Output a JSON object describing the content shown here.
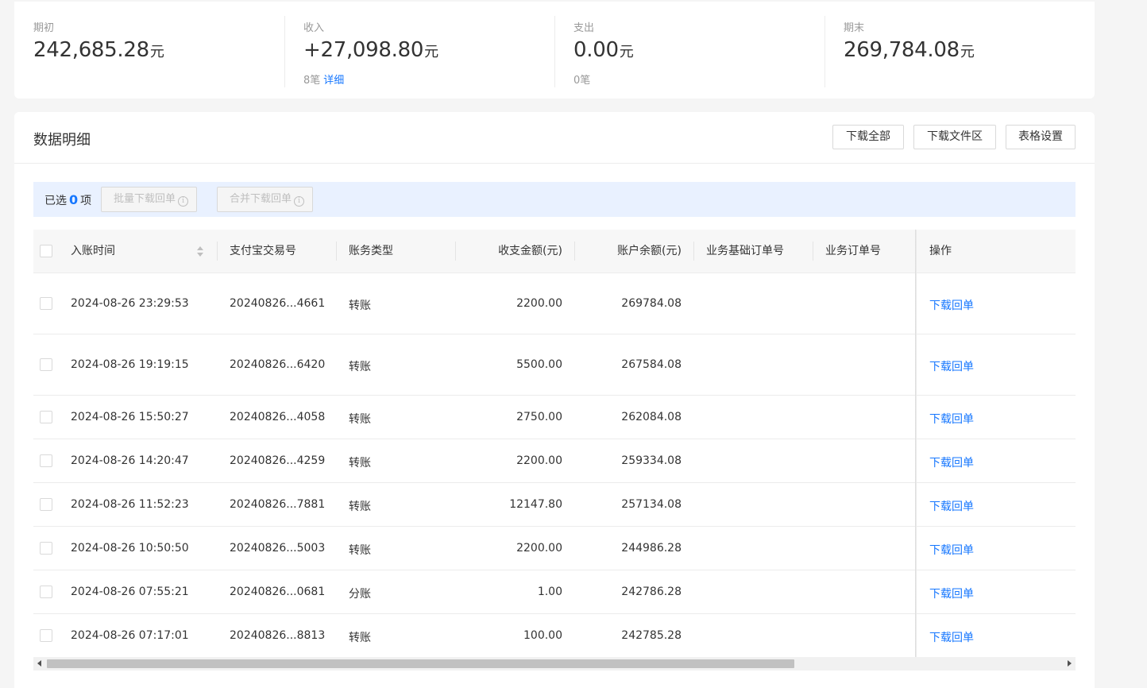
{
  "summary": {
    "opening": {
      "label": "期初",
      "value": "242,685.28",
      "unit": "元"
    },
    "income": {
      "label": "收入",
      "value": "+27,098.80",
      "unit": "元",
      "count": "8笔",
      "detail_link": "详细"
    },
    "expense": {
      "label": "支出",
      "value": "0.00",
      "unit": "元",
      "count": "0笔"
    },
    "closing": {
      "label": "期末",
      "value": "269,784.08",
      "unit": "元"
    }
  },
  "detail": {
    "title": "数据明细",
    "buttons": {
      "download_all": "下载全部",
      "download_files": "下载文件区",
      "table_settings": "表格设置"
    },
    "selection": {
      "prefix": "已选",
      "count": "0",
      "suffix": "项",
      "batch_download": "批量下载回单",
      "merge_download": "合并下载回单"
    }
  },
  "table": {
    "columns": {
      "time": "入账时间",
      "trade_no": "支付宝交易号",
      "type": "账务类型",
      "amount": "收支金额(元)",
      "balance": "账户余额(元)",
      "base_order": "业务基础订单号",
      "order": "业务订单号",
      "action": "操作"
    },
    "rows": [
      {
        "time": "2024-08-26 23:29:53",
        "trade_no": "20240826...4661",
        "type": "转账",
        "amount": "2200.00",
        "balance": "269784.08",
        "action": "下载回单"
      },
      {
        "time": "2024-08-26 19:19:15",
        "trade_no": "20240826...6420",
        "type": "转账",
        "amount": "5500.00",
        "balance": "267584.08",
        "action": "下载回单"
      },
      {
        "time": "2024-08-26 15:50:27",
        "trade_no": "20240826...4058",
        "type": "转账",
        "amount": "2750.00",
        "balance": "262084.08",
        "action": "下载回单"
      },
      {
        "time": "2024-08-26 14:20:47",
        "trade_no": "20240826...4259",
        "type": "转账",
        "amount": "2200.00",
        "balance": "259334.08",
        "action": "下载回单"
      },
      {
        "time": "2024-08-26 11:52:23",
        "trade_no": "20240826...7881",
        "type": "转账",
        "amount": "12147.80",
        "balance": "257134.08",
        "action": "下载回单"
      },
      {
        "time": "2024-08-26 10:50:50",
        "trade_no": "20240826...5003",
        "type": "转账",
        "amount": "2200.00",
        "balance": "244986.28",
        "action": "下载回单"
      },
      {
        "time": "2024-08-26 07:55:21",
        "trade_no": "20240826...0681",
        "type": "分账",
        "amount": "1.00",
        "balance": "242786.28",
        "action": "下载回单"
      },
      {
        "time": "2024-08-26 07:17:01",
        "trade_no": "20240826...8813",
        "type": "转账",
        "amount": "100.00",
        "balance": "242785.28",
        "action": "下载回单"
      }
    ]
  },
  "colors": {
    "accent": "#1677ff",
    "selection_bg": "#e9f1ff"
  }
}
